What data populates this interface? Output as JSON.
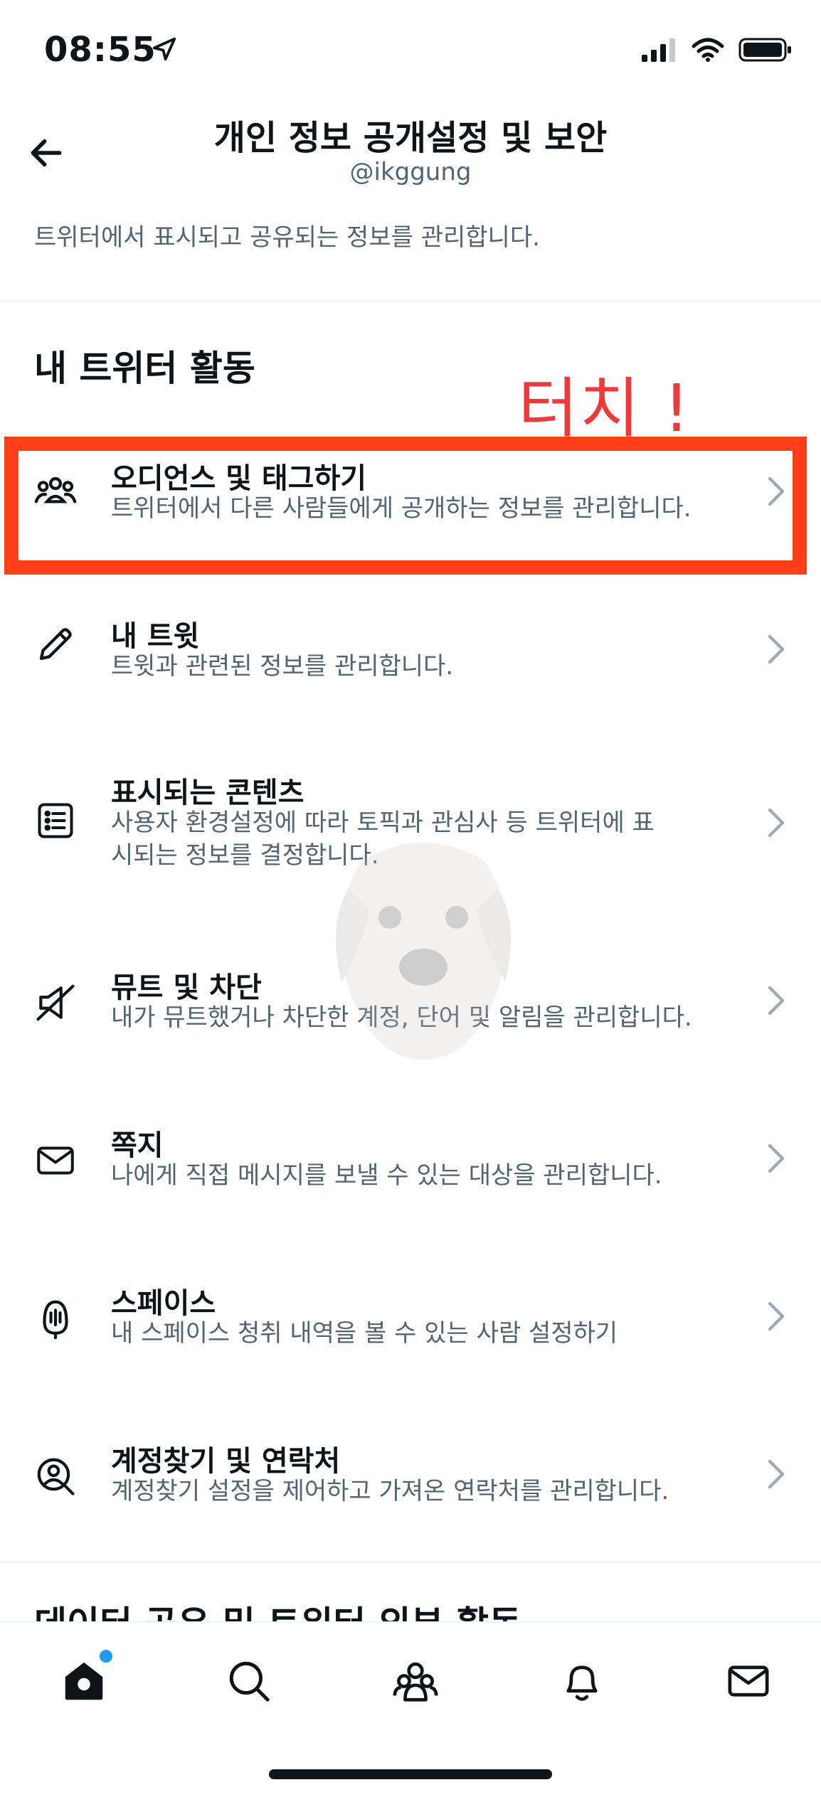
{
  "status_bar": {
    "time": "08:55"
  },
  "header": {
    "title": "개인 정보 공개설정 및 보안",
    "handle": "@ikggung"
  },
  "intro": "트위터에서 표시되고 공유되는 정보를 관리합니다.",
  "section": {
    "title": "내 트위터 활동"
  },
  "annotation": {
    "text": "터치 !",
    "color": "#f03a3a",
    "highlight_color": "#ff3d17"
  },
  "items": [
    {
      "title": "오디언스 및 태그하기",
      "desc": "트위터에서 다른 사람들에게 공개하는 정보를 관리합니다.",
      "icon": "people-icon"
    },
    {
      "title": "내 트윗",
      "desc": "트윗과 관련된 정보를 관리합니다.",
      "icon": "pencil-icon"
    },
    {
      "title": "표시되는 콘텐츠",
      "desc": "사용자 환경설정에 따라 토픽과 관심사 등 트위터에 표시되는 정보를 결정합니다.",
      "icon": "list-icon"
    },
    {
      "title": "뮤트 및 차단",
      "desc": "내가 뮤트했거나 차단한 계정, 단어 및 알림을 관리합니다.",
      "icon": "mute-icon"
    },
    {
      "title": "쪽지",
      "desc": "나에게 직접 메시지를 보낼 수 있는 대상을 관리합니다.",
      "icon": "envelope-icon"
    },
    {
      "title": "스페이스",
      "desc": "내 스페이스 청취 내역을 볼 수 있는 사람 설정하기",
      "icon": "microphone-icon"
    },
    {
      "title": "계정찾기 및 연락처",
      "desc": "계정찾기 설정을 제어하고 가져온 연락처를 관리합니다.",
      "icon": "find-contacts-icon"
    }
  ],
  "next_section": {
    "title": "데이터 공유 및 트위터 외부 활동"
  },
  "tab_bar": [
    "home-icon",
    "search-icon",
    "communities-icon",
    "notifications-icon",
    "messages-icon"
  ],
  "colors": {
    "accent": "#1d9bf0",
    "text": "#0f1419",
    "secondary": "#536471"
  }
}
